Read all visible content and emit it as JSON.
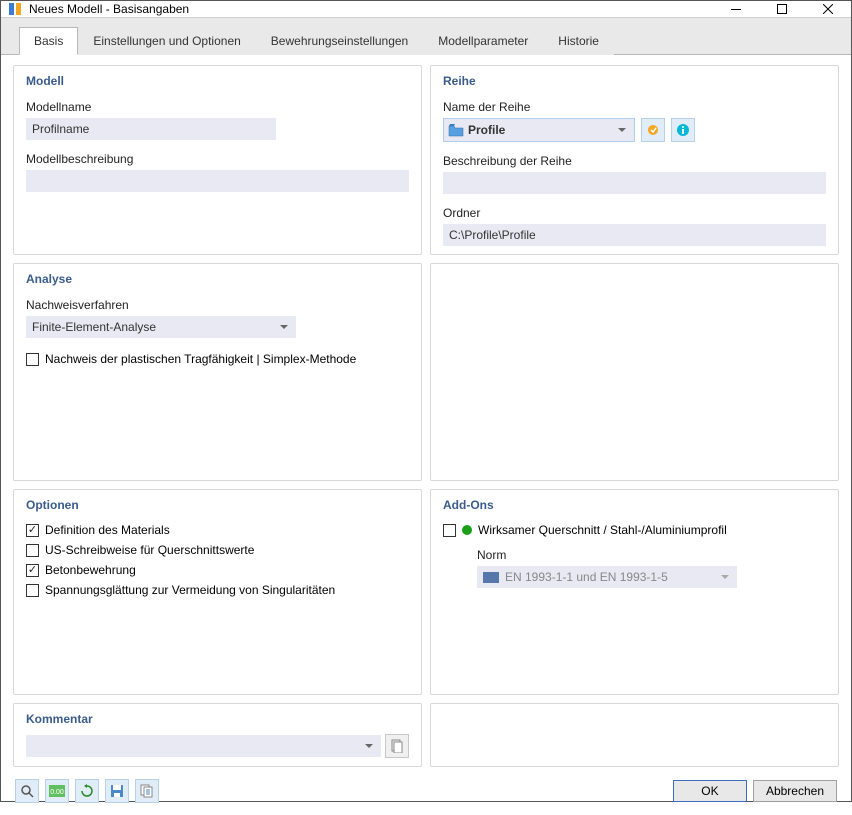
{
  "window": {
    "title": "Neues Modell - Basisangaben"
  },
  "tabs": [
    {
      "label": "Basis",
      "active": true
    },
    {
      "label": "Einstellungen und Optionen",
      "active": false
    },
    {
      "label": "Bewehrungseinstellungen",
      "active": false
    },
    {
      "label": "Modellparameter",
      "active": false
    },
    {
      "label": "Historie",
      "active": false
    }
  ],
  "modell": {
    "title": "Modell",
    "name_label": "Modellname",
    "name_value": "Profilname",
    "desc_label": "Modellbeschreibung",
    "desc_value": ""
  },
  "reihe": {
    "title": "Reihe",
    "name_label": "Name der Reihe",
    "select_value": "Profile",
    "desc_label": "Beschreibung der Reihe",
    "desc_value": "",
    "folder_label": "Ordner",
    "folder_value": "C:\\Profile\\Profile"
  },
  "analyse": {
    "title": "Analyse",
    "method_label": "Nachweisverfahren",
    "method_value": "Finite-Element-Analyse",
    "plastic_label": "Nachweis der plastischen Tragfähigkeit | Simplex-Methode",
    "plastic_checked": false
  },
  "optionen": {
    "title": "Optionen",
    "items": [
      {
        "label": "Definition des Materials",
        "checked": true
      },
      {
        "label": "US-Schreibweise für Querschnittswerte",
        "checked": false
      },
      {
        "label": "Betonbewehrung",
        "checked": true
      },
      {
        "label": "Spannungsglättung zur Vermeidung von Singularitäten",
        "checked": false
      }
    ]
  },
  "addons": {
    "title": "Add-Ons",
    "eff_label": "Wirksamer Querschnitt / Stahl-/Aluminiumprofil",
    "eff_checked": false,
    "norm_label": "Norm",
    "norm_value": "EN 1993-1-1 und EN 1993-1-5"
  },
  "kommentar": {
    "title": "Kommentar",
    "value": ""
  },
  "buttons": {
    "ok": "OK",
    "cancel": "Abbrechen"
  }
}
